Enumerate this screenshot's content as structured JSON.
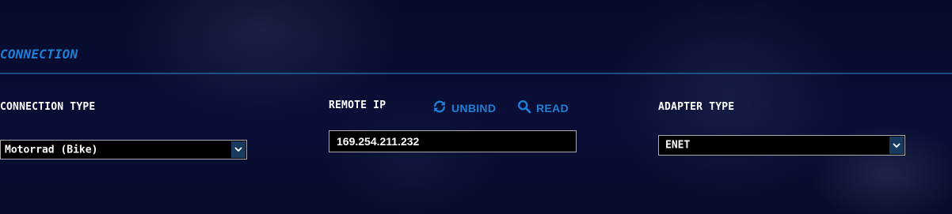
{
  "section": {
    "title": "CONNECTION"
  },
  "connection_type": {
    "label": "CONNECTION TYPE",
    "selected": "Motorrad (Bike)"
  },
  "remote_ip": {
    "label": "REMOTE IP",
    "value": "169.254.211.232",
    "unbind_label": "UNBIND",
    "read_label": "READ"
  },
  "adapter_type": {
    "label": "ADAPTER TYPE",
    "selected": "ENET"
  },
  "icons": {
    "unbind": "refresh-icon",
    "read": "search-icon",
    "dropdown": "chevron-down-icon"
  },
  "colors": {
    "accent": "#1f7fd6",
    "background": "#070b2e",
    "divider": "#1c4f86",
    "field_background": "#000000",
    "dropdown_arrow_background": "#183a5e"
  }
}
